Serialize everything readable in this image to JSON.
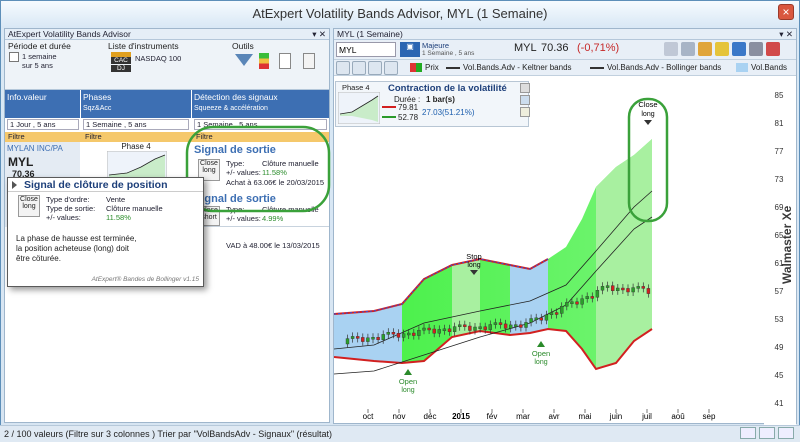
{
  "window": {
    "title": "AtExpert Volatility Bands Advisor, MYL (1 Semaine)",
    "close_glyph": "×"
  },
  "left": {
    "panel_title": "AtExpert Volatility Bands Advisor",
    "period_label": "Période et durée",
    "period_line1": "1 semaine",
    "period_line2": "sur 5 ans",
    "instruments_label": "Liste d'instruments",
    "instruments_value": "NASDAQ 100",
    "inst_tags": [
      "CAC",
      "DJ"
    ],
    "tools_label": "Outils",
    "col1": {
      "title": "Info.valeur",
      "select": "1 Jour , 5 ans"
    },
    "col2": {
      "title": "Phases",
      "sub": "Sqz&Acc",
      "select": "1 Semaine , 5 ans"
    },
    "col3": {
      "title": "Détection des signaux",
      "sub": "Squeeze & accélération",
      "select": "1 Semaine , 5 ans"
    },
    "filter_label": "Filtre",
    "stock": {
      "name": "MYLAN INC/PA",
      "ticker": "MYL",
      "price": "70.36",
      "phase": "Phase 4"
    },
    "signal1": {
      "title": "Signal de sortie",
      "badge1": "Close",
      "badge2": "long",
      "type_label": "Type:",
      "type_value": "Clôture manuelle",
      "values_label": "+/- values:",
      "values_value": "11.58%",
      "note": "Achat à 63.06€ le 20/03/2015"
    },
    "signal2": {
      "title": "Signal de sortie",
      "badge1": "Close",
      "badge2": "short",
      "type_label": "Type:",
      "type_value": "Clôture manuelle",
      "values_label": "+/- values:",
      "values_value": "4.99%",
      "note": "VAD à 48.00€ le 13/03/2015"
    }
  },
  "tooltip": {
    "title": "Signal de clôture de position",
    "badge1": "Close",
    "badge2": "long",
    "order_label": "Type d'ordre:",
    "order_value": "Vente",
    "exit_label": "Type de sortie:",
    "exit_value": "Clôture manuelle",
    "values_label": "+/- values:",
    "values_value": "11.58%",
    "text1": "La phase de hausse est terminée,",
    "text2": "la position acheteuse (long) doit",
    "text3": "être cöturée.",
    "footer": "AtExpert® Bandes de Bollinger v1.15"
  },
  "chart": {
    "panel_title": "MYL (1 Semaine)",
    "symbol_input": "MYL",
    "index_label1": "Majeure",
    "index_label2": "1 Semaine , 5 ans",
    "quote_symbol": "MYL",
    "quote_price": "70.36",
    "quote_change": "(-0,71%)",
    "legend": {
      "prix": "Prix",
      "keltner": "Vol.Bands.Adv - Keltner bands",
      "bollinger": "Vol.Bands.Adv - Bollinger bands",
      "vol": "Vol.Bands"
    },
    "info_box": {
      "phase": "Phase 4",
      "title": "Contraction de la volatilité",
      "duration_label": "Durée :",
      "duration_value": "1 bar(s)",
      "v1": "79.81",
      "v2": "52.78",
      "v3": "27.03(51.21%)"
    },
    "yticks": [
      "85",
      "81",
      "77",
      "73",
      "69",
      "65",
      "61",
      "57",
      "53",
      "49",
      "45",
      "41"
    ],
    "xticks": [
      "oct",
      "nov",
      "déc",
      "2015",
      "fév",
      "mar",
      "avr",
      "mai",
      "juin",
      "juil",
      "aoû",
      "sep"
    ],
    "annotations": {
      "close1": "Close",
      "close2": "long",
      "stop1": "Stop",
      "stop2": "long",
      "open_a1": "Open",
      "open_a2": "long",
      "open_b1": "Open",
      "open_b2": "long"
    },
    "watermark": "Walmaster Xe"
  },
  "status": {
    "text": "2 / 100 valeurs (Filtre sur 3 colonnes ) Trier par \"VolBandsAdv - Signaux\" (résultat)"
  },
  "colors": {
    "accent_blue": "#3d6fb3",
    "band_green": "#3bf03b",
    "light_green": "#a8f0a0",
    "band_blue": "#a9d2f2",
    "bear_red": "#d22020",
    "bull_green": "#2aa02a"
  }
}
